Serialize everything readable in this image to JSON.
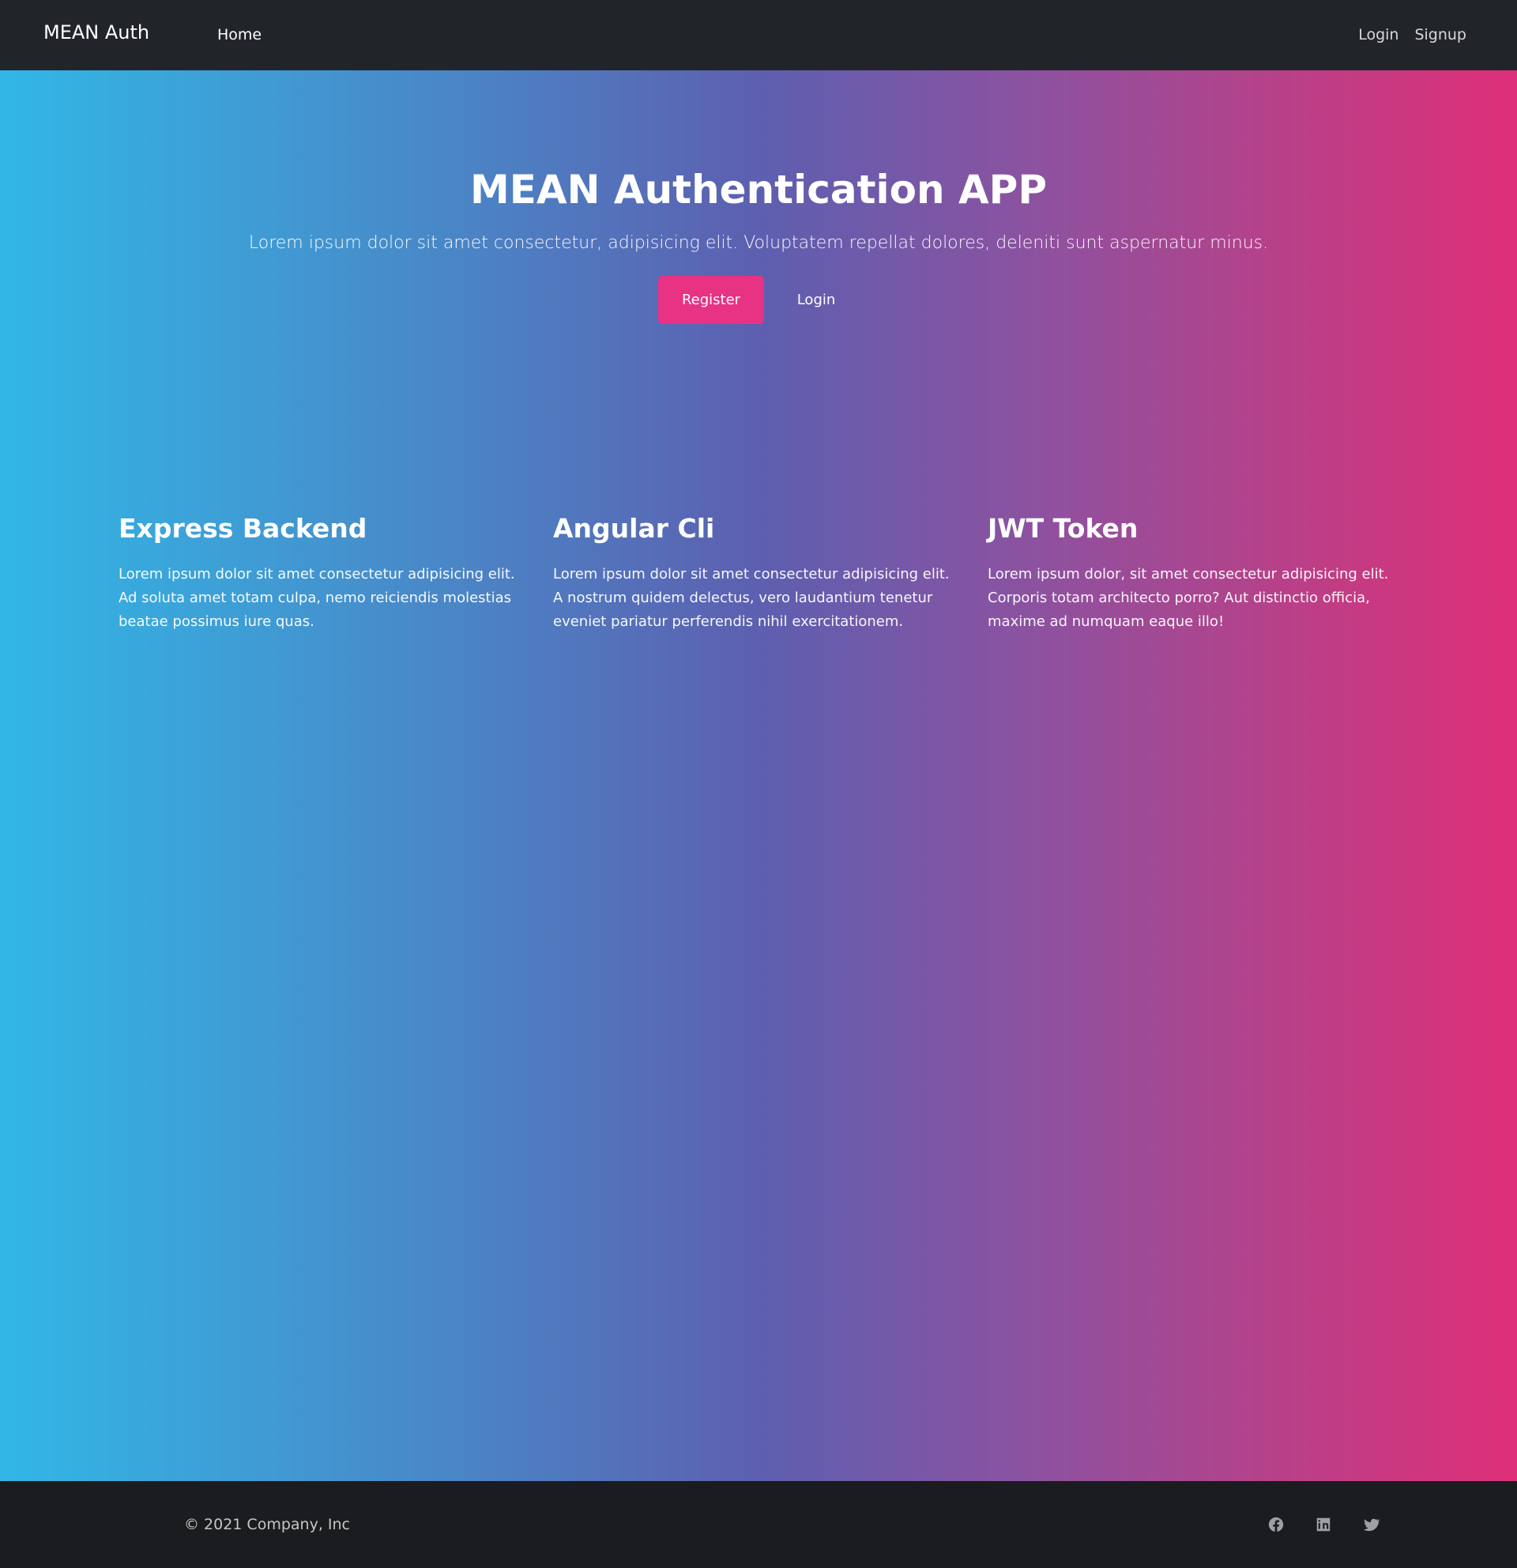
{
  "navbar": {
    "brand": "MEAN Auth",
    "home_label": "Home",
    "login_label": "Login",
    "signup_label": "Signup"
  },
  "hero": {
    "title": "MEAN Authentication APP",
    "subtitle": "Lorem ipsum dolor sit amet consectetur, adipisicing elit. Voluptatem repellat dolores, deleniti sunt aspernatur minus.",
    "register_label": "Register",
    "login_label": "Login"
  },
  "features": [
    {
      "title": "Express Backend",
      "text": "Lorem ipsum dolor sit amet consectetur adipisicing elit. Ad soluta amet totam culpa, nemo reiciendis molestias beatae possimus iure quas."
    },
    {
      "title": "Angular Cli",
      "text": "Lorem ipsum dolor sit amet consectetur adipisicing elit. A nostrum quidem delectus, vero laudantium tenetur eveniet pariatur perferendis nihil exercitationem."
    },
    {
      "title": "JWT Token",
      "text": "Lorem ipsum dolor, sit amet consectetur adipisicing elit. Corporis totam architecto porro? Aut distinctio officia, maxime ad numquam eaque illo!"
    }
  ],
  "footer": {
    "copyright": "© 2021 Company, Inc",
    "socials": [
      "facebook-icon",
      "linkedin-icon",
      "twitter-icon"
    ]
  },
  "colors": {
    "navbar_bg": "#212529",
    "register_button": "#e83283",
    "gradient_start": "#31b7e6",
    "gradient_end": "#df2f79",
    "footer_bg": "#1b1c1f"
  }
}
